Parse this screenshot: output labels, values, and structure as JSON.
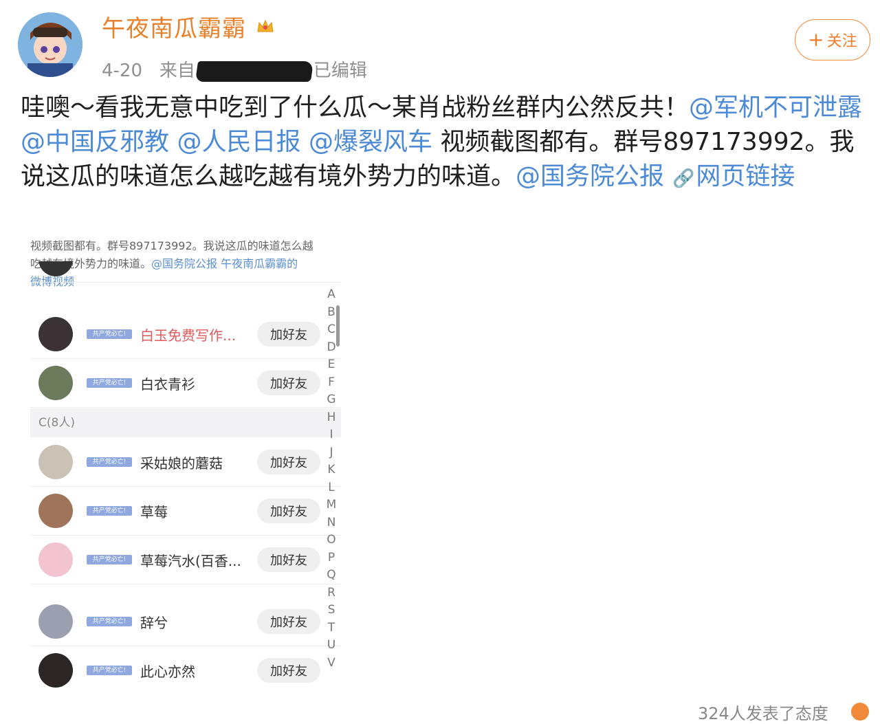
{
  "post": {
    "username": "午夜南瓜霸霸",
    "date": "4-20",
    "source_prefix": "来自",
    "edited": "已编辑",
    "follow_label": "关注",
    "text_1": "哇噢～看我无意中吃到了什么瓜～某肖战粉丝群内公然反共！",
    "mention_1": "@军机不可泄露",
    "mention_2": "@中国反邪教",
    "mention_3": "@人民日报",
    "mention_4": "@爆裂风车",
    "text_2": " 视频截图都有。群号897173992。我说这瓜的味道怎么越吃越有境外势力的味道。",
    "mention_5": "@国务院公报",
    "link_label": "网页链接"
  },
  "screenshot": {
    "caption_line1": "视频截图都有。群号897173992。我说这瓜的味道怎么越",
    "caption_line2_text": "吃越有境外势力的味道。",
    "caption_line2_mention": "@国务院公报",
    "caption_line2_link": "午夜南瓜霸霸的",
    "caption_line3": "微博视频",
    "section_header": "C(8人)",
    "add_label": "加好友",
    "badge_text": "共产党必亡!",
    "members": [
      {
        "name": "白玉免费写作..."
      },
      {
        "name": "白衣青衫"
      },
      {
        "name": "采姑娘的蘑菇"
      },
      {
        "name": "草莓"
      },
      {
        "name": "草莓汽水(百香..."
      },
      {
        "name": "辞兮"
      },
      {
        "name": "此心亦然"
      }
    ],
    "az_index": [
      "A",
      "B",
      "C",
      "D",
      "E",
      "F",
      "G",
      "H",
      "I",
      "J",
      "K",
      "L",
      "M",
      "N",
      "O",
      "P",
      "Q",
      "R",
      "S",
      "T",
      "U",
      "V"
    ]
  },
  "footer": {
    "text": "324人发表了态度"
  },
  "colors": {
    "username": "#e8812b",
    "mention": "#4c8ad6",
    "follow_border": "#f08a3a"
  }
}
